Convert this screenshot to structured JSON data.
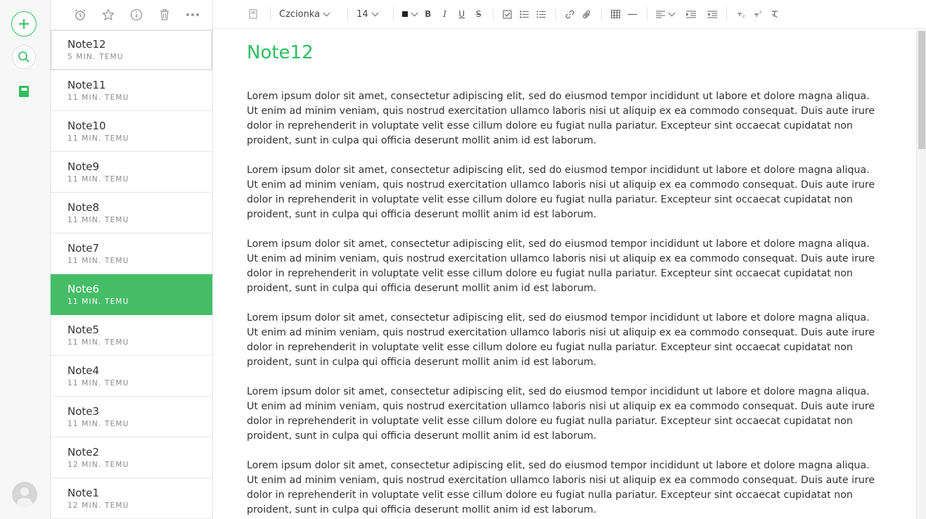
{
  "rail": {
    "new_note_icon": "plus-icon",
    "search_icon": "search-icon",
    "notebooks_icon": "notebook-icon",
    "avatar_icon": "user-avatar-icon",
    "accent": "#2dbe60"
  },
  "list_toolbar": {
    "icons": [
      "alarm-icon",
      "star-icon",
      "info-icon",
      "trash-icon",
      "more-icon"
    ]
  },
  "notes": [
    {
      "title": "Note12",
      "time": "5 MIN. TEMU"
    },
    {
      "title": "Note11",
      "time": "11 MIN. TEMU"
    },
    {
      "title": "Note10",
      "time": "11 MIN. TEMU"
    },
    {
      "title": "Note9",
      "time": "11 MIN. TEMU"
    },
    {
      "title": "Note8",
      "time": "11 MIN. TEMU"
    },
    {
      "title": "Note7",
      "time": "11 MIN. TEMU"
    },
    {
      "title": "Note6",
      "time": "11 MIN. TEMU"
    },
    {
      "title": "Note5",
      "time": "11 MIN. TEMU"
    },
    {
      "title": "Note4",
      "time": "11 MIN. TEMU"
    },
    {
      "title": "Note3",
      "time": "11 MIN. TEMU"
    },
    {
      "title": "Note2",
      "time": "12 MIN. TEMU"
    },
    {
      "title": "Note1",
      "time": "12 MIN. TEMU"
    }
  ],
  "selected_note_color": "#45bd67",
  "format_bar": {
    "font_label": "Czcionka",
    "font_size": "14"
  },
  "editor": {
    "title": "Note12",
    "paragraphs": [
      "Lorem ipsum dolor sit amet, consectetur adipiscing elit, sed do eiusmod tempor incididunt ut labore et dolore magna aliqua. Ut enim ad minim veniam, quis nostrud exercitation ullamco laboris nisi ut aliquip ex ea commodo consequat. Duis aute irure dolor in reprehenderit in voluptate velit esse cillum dolore eu fugiat nulla pariatur. Excepteur sint occaecat cupidatat non proident, sunt in culpa qui officia deserunt mollit anim id est laborum.",
      "Lorem ipsum dolor sit amet, consectetur adipiscing elit, sed do eiusmod tempor incididunt ut labore et dolore magna aliqua. Ut enim ad minim veniam, quis nostrud exercitation ullamco laboris nisi ut aliquip ex ea commodo consequat. Duis aute irure dolor in reprehenderit in voluptate velit esse cillum dolore eu fugiat nulla pariatur. Excepteur sint occaecat cupidatat non proident, sunt in culpa qui officia deserunt mollit anim id est laborum.",
      "Lorem ipsum dolor sit amet, consectetur adipiscing elit, sed do eiusmod tempor incididunt ut labore et dolore magna aliqua. Ut enim ad minim veniam, quis nostrud exercitation ullamco laboris nisi ut aliquip ex ea commodo consequat. Duis aute irure dolor in reprehenderit in voluptate velit esse cillum dolore eu fugiat nulla pariatur. Excepteur sint occaecat cupidatat non proident, sunt in culpa qui officia deserunt mollit anim id est laborum.",
      "Lorem ipsum dolor sit amet, consectetur adipiscing elit, sed do eiusmod tempor incididunt ut labore et dolore magna aliqua. Ut enim ad minim veniam, quis nostrud exercitation ullamco laboris nisi ut aliquip ex ea commodo consequat. Duis aute irure dolor in reprehenderit in voluptate velit esse cillum dolore eu fugiat nulla pariatur. Excepteur sint occaecat cupidatat non proident, sunt in culpa qui officia deserunt mollit anim id est laborum.",
      "Lorem ipsum dolor sit amet, consectetur adipiscing elit, sed do eiusmod tempor incididunt ut labore et dolore magna aliqua. Ut enim ad minim veniam, quis nostrud exercitation ullamco laboris nisi ut aliquip ex ea commodo consequat. Duis aute irure dolor in reprehenderit in voluptate velit esse cillum dolore eu fugiat nulla pariatur. Excepteur sint occaecat cupidatat non proident, sunt in culpa qui officia deserunt mollit anim id est laborum.",
      "Lorem ipsum dolor sit amet, consectetur adipiscing elit, sed do eiusmod tempor incididunt ut labore et dolore magna aliqua. Ut enim ad minim veniam, quis nostrud exercitation ullamco laboris nisi ut aliquip ex ea commodo consequat. Duis aute irure dolor in reprehenderit in voluptate velit esse cillum dolore eu fugiat nulla pariatur. Excepteur sint occaecat cupidatat non proident, sunt in culpa qui officia deserunt mollit anim id est laborum."
    ]
  }
}
